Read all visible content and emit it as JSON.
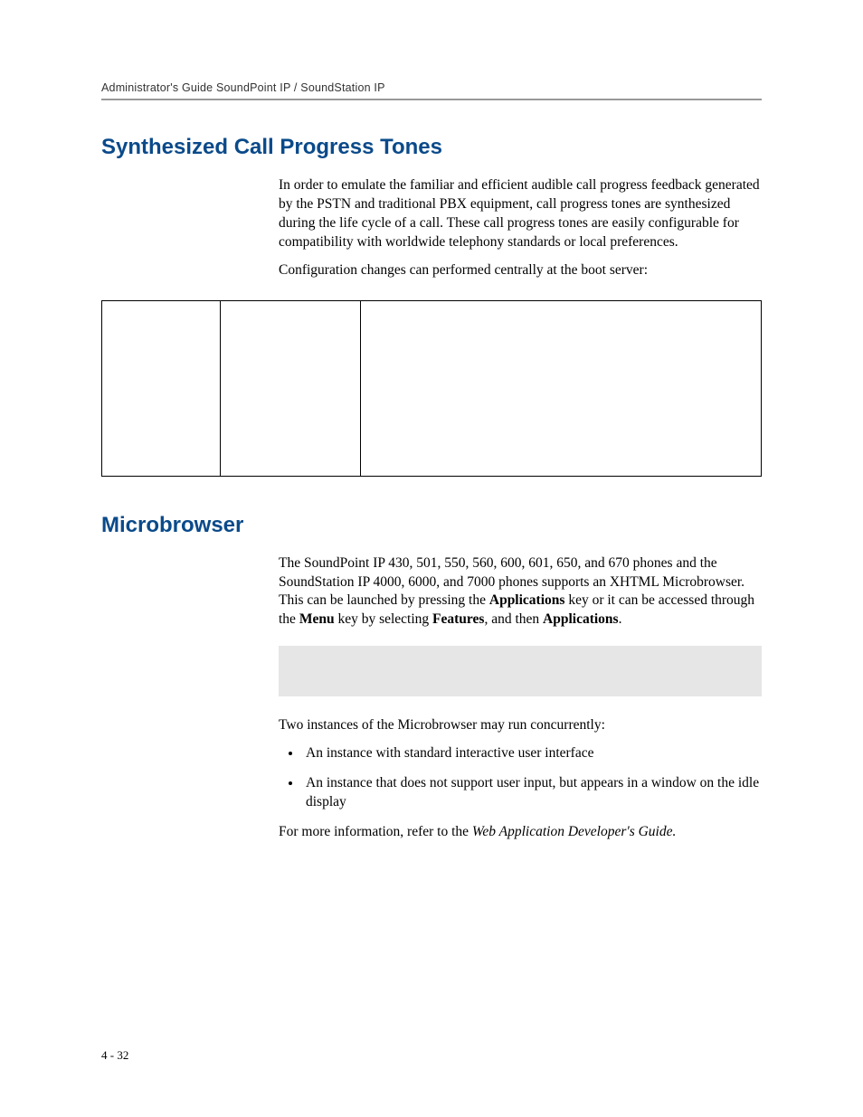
{
  "running_header": "Administrator's Guide SoundPoint IP / SoundStation IP",
  "section1": {
    "heading": "Synthesized Call Progress Tones",
    "para1": "In order to emulate the familiar and efficient audible call progress feedback generated by the PSTN and traditional PBX equipment, call progress tones are synthesized during the life cycle of a call. These call progress tones are easily configurable for compatibility with worldwide telephony standards or local preferences.",
    "para2": "Configuration changes can performed centrally at the boot server:"
  },
  "section2": {
    "heading": "Microbrowser",
    "para1_a": "The SoundPoint IP 430, 501, 550, 560, 600, 601, 650, and 670 phones and the SoundStation IP 4000, 6000, and 7000 phones supports an XHTML Microbrowser. This can be launched by pressing the ",
    "para1_b_bold": "Applications",
    "para1_c": " key or it can be accessed through the ",
    "para1_d_bold": "Menu",
    "para1_e": " key by selecting ",
    "para1_f_bold": "Features",
    "para1_g": ", and then ",
    "para1_h_bold": "Applications",
    "para1_i": ".",
    "para2": "Two instances of the Microbrowser may run concurrently:",
    "bullets": [
      "An instance with standard interactive user interface",
      "An instance that does not support user input, but appears in a window on the idle display"
    ],
    "para3_a": "For more information, refer to the ",
    "para3_b_italic": "Web Application Developer's Guide.",
    "para3_c": ""
  },
  "page_number": "4 - 32"
}
